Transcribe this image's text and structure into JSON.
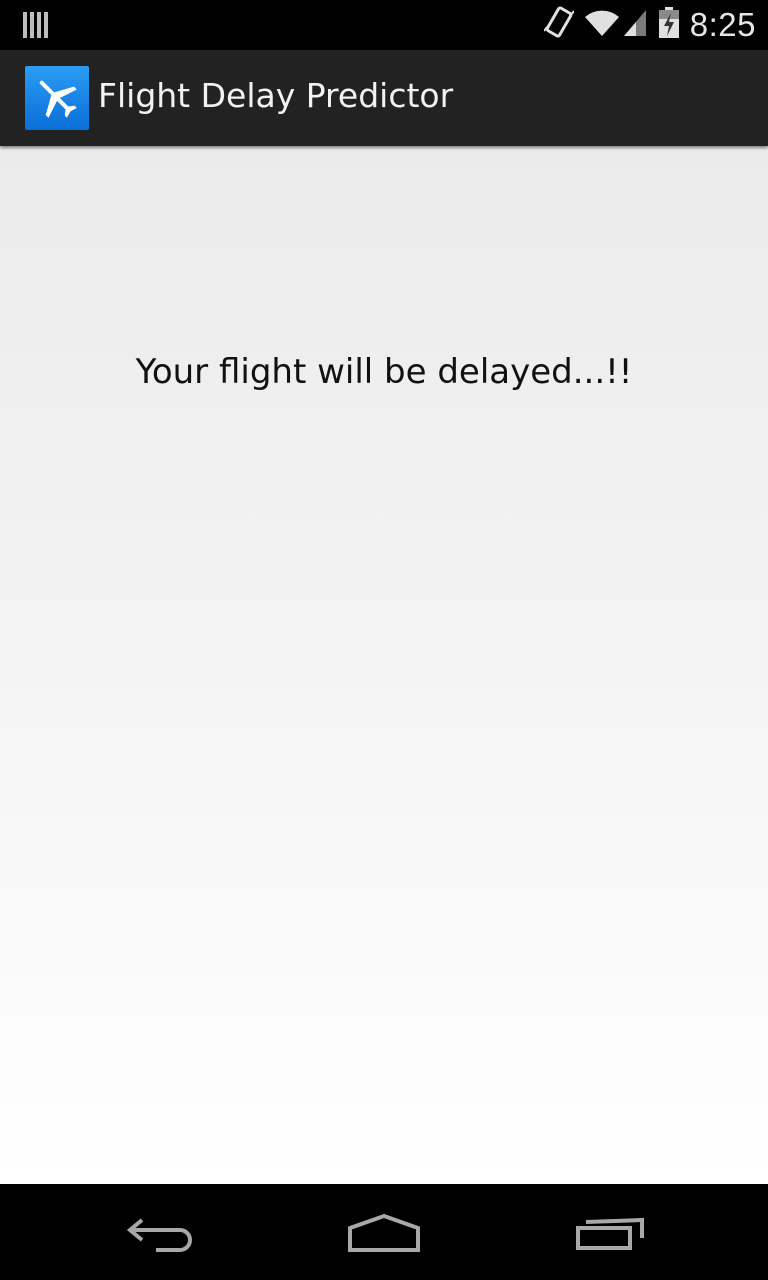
{
  "status_bar": {
    "time": "8:25",
    "icons": [
      "notification-bars-icon",
      "vibrate-icon",
      "wifi-icon",
      "signal-icon",
      "battery-icon"
    ]
  },
  "action_bar": {
    "title": "Flight Delay Predictor",
    "app_icon": "airplane-icon",
    "icon_color": "#1a86e6"
  },
  "content": {
    "message": "Your flight will be delayed...!!"
  },
  "nav_bar": {
    "buttons": [
      "back-icon",
      "home-icon",
      "recents-icon"
    ]
  }
}
